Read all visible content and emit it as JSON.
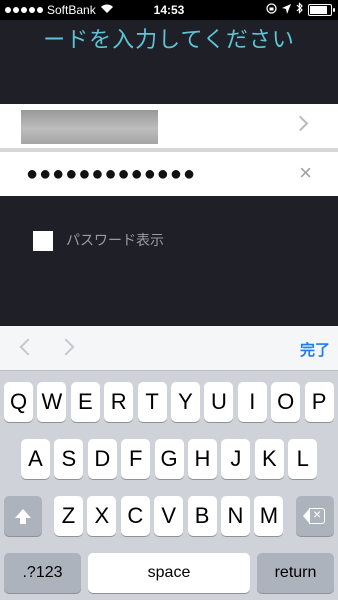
{
  "status": {
    "carrier": "SoftBank",
    "time": "14:53",
    "battery_level": 0.95
  },
  "title": "ードを入力してください",
  "password_masked": "●●●●●●●●●●●●●",
  "clear_glyph": "×",
  "show_password_label": "パスワード表示",
  "show_password_checked": false,
  "toolbar": {
    "done_label": "完了"
  },
  "keyboard": {
    "row1": [
      "Q",
      "W",
      "E",
      "R",
      "T",
      "Y",
      "U",
      "I",
      "O",
      "P"
    ],
    "row2": [
      "A",
      "S",
      "D",
      "F",
      "G",
      "H",
      "J",
      "K",
      "L"
    ],
    "row3": [
      "Z",
      "X",
      "C",
      "V",
      "B",
      "N",
      "M"
    ],
    "num_label": ".?123",
    "space_label": "space",
    "return_label": "return"
  }
}
